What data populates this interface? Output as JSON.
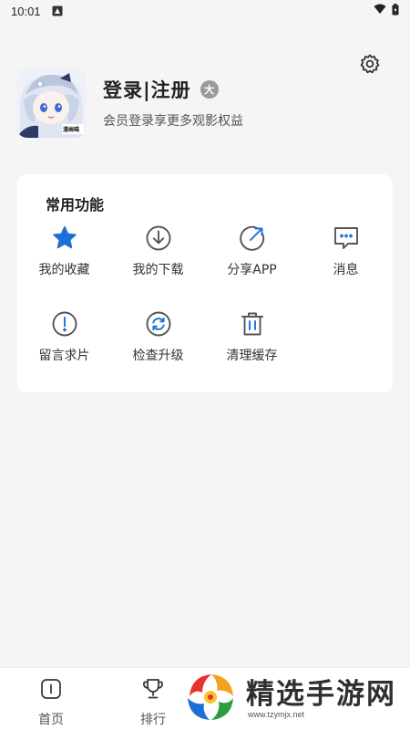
{
  "status": {
    "time": "10:01"
  },
  "profile": {
    "title": "登录|注册",
    "subtitle": "会员登录享更多观影权益",
    "level_badge": "大",
    "avatar_label": "漫画喵"
  },
  "functions": {
    "title": "常用功能",
    "items": [
      {
        "label": "我的收藏",
        "icon": "star-icon"
      },
      {
        "label": "我的下载",
        "icon": "download-icon"
      },
      {
        "label": "分享APP",
        "icon": "share-icon"
      },
      {
        "label": "消息",
        "icon": "message-icon"
      },
      {
        "label": "留言求片",
        "icon": "exclamation-icon"
      },
      {
        "label": "检查升级",
        "icon": "refresh-icon"
      },
      {
        "label": "清理缓存",
        "icon": "trash-icon"
      }
    ]
  },
  "tabbar": {
    "tabs": [
      {
        "label": "首页",
        "icon": "home-icon"
      },
      {
        "label": "排行",
        "icon": "trophy-icon"
      }
    ]
  },
  "watermark": {
    "title": "精选手游网",
    "url": "www.tzymjx.net"
  },
  "colors": {
    "accent": "#1d6fd8",
    "icon_gray": "#555555",
    "background": "#f5f5f5"
  }
}
